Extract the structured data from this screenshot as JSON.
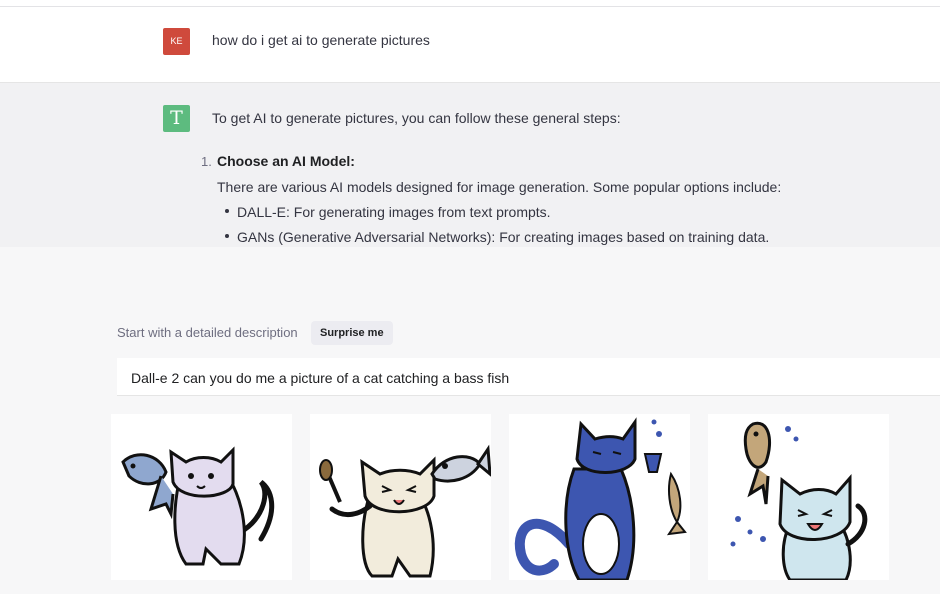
{
  "conversation": {
    "user": {
      "avatar_initials": "KE",
      "avatar_color": "#cf4a3c",
      "message": "how do i get ai to generate pictures"
    },
    "assistant": {
      "avatar_letter": "T",
      "avatar_color": "#5dbb7f",
      "intro": "To get AI to generate pictures, you can follow these general steps:",
      "steps": [
        {
          "number": "1.",
          "title": "Choose an AI Model:",
          "description": "There are various AI models designed for image generation. Some popular options include:",
          "bullets": [
            "DALL-E: For generating images from text prompts.",
            "GANs (Generative Adversarial Networks): For creating images based on training data."
          ]
        }
      ]
    }
  },
  "prompt": {
    "label": "Start with a detailed description",
    "surprise_label": "Surprise me",
    "value": "Dall-e 2 can you do me a picture of a cat catching a bass fish"
  },
  "results": [
    {
      "icon": "cat-holding-fish-image",
      "cat_color": "#e3dcef"
    },
    {
      "icon": "cat-with-brush-and-fish-image",
      "cat_color": "#f2ecdc"
    },
    {
      "icon": "blue-cat-with-cup-and-fish-image",
      "cat_color": "#3d56b0"
    },
    {
      "icon": "cat-splashing-fish-image",
      "cat_color": "#cfe6ee"
    }
  ]
}
